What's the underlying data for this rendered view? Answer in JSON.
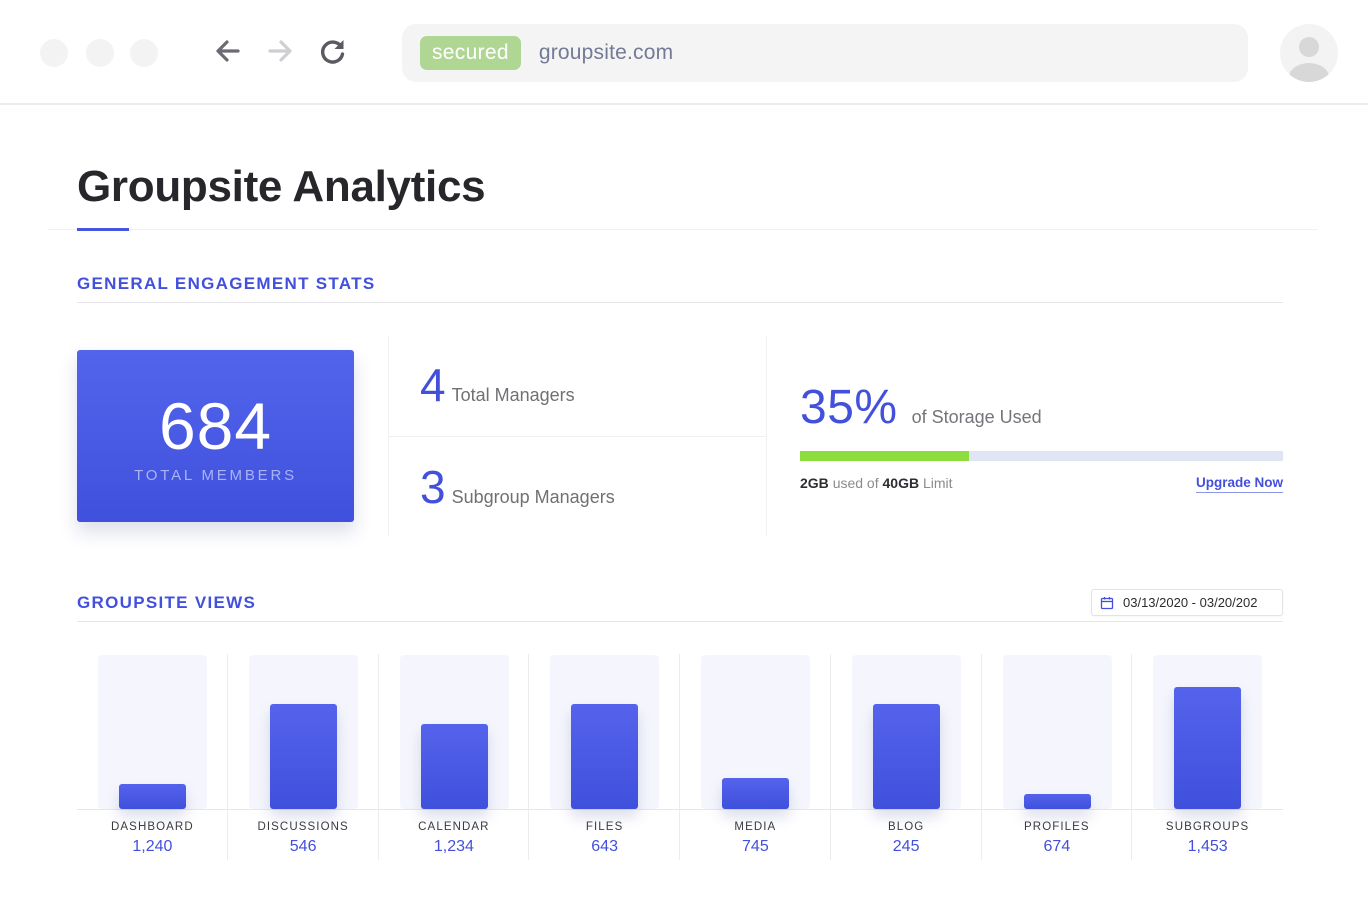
{
  "browser": {
    "window_controls": [
      "close",
      "minimize",
      "maximize"
    ],
    "nav": {
      "back_icon": "arrow-left-icon",
      "forward_icon": "arrow-right-icon",
      "reload_icon": "reload-icon"
    },
    "security_badge": "secured",
    "url": "groupsite.com",
    "avatar_icon": "user-avatar-icon"
  },
  "page": {
    "title": "Groupsite Analytics"
  },
  "engagement": {
    "heading": "GENERAL ENGAGEMENT STATS",
    "total_members": {
      "value": "684",
      "label": "TOTAL MEMBERS"
    },
    "managers": [
      {
        "value": "4",
        "label": "Total Managers"
      },
      {
        "value": "3",
        "label": "Subgroup Managers"
      }
    ],
    "storage": {
      "percent_text": "35%",
      "percent_label": "of Storage Used",
      "fill_fraction": 0.35,
      "used": "2GB",
      "used_of_text": "used of",
      "limit": "40GB",
      "limit_text": "Limit",
      "upgrade_label": "Upgrade Now",
      "colors": {
        "fill": "#8edd3e",
        "track": "#dfe5f2"
      }
    }
  },
  "views": {
    "heading": "GROUPSITE VIEWS",
    "date_range": "03/13/2020 - 03/20/202",
    "calendar_icon": "calendar-icon"
  },
  "chart_data": {
    "type": "bar",
    "title": "GROUPSITE VIEWS",
    "categories": [
      "DASHBOARD",
      "DISCUSSIONS",
      "CALENDAR",
      "FILES",
      "MEDIA",
      "BLOG",
      "PROFILES",
      "SUBGROUPS"
    ],
    "values_printed": [
      "1,240",
      "546",
      "1,234",
      "643",
      "745",
      "245",
      "674",
      "1,453"
    ],
    "values": [
      1240,
      546,
      1234,
      643,
      745,
      245,
      674,
      1453
    ],
    "bar_fill_fraction": [
      0.16,
      0.68,
      0.55,
      0.68,
      0.2,
      0.68,
      0.1,
      0.79
    ],
    "xlabel": "",
    "ylabel": "",
    "grid": false,
    "colors": {
      "bar": "#4757e4",
      "track": "#f5f6fd",
      "value_text": "#4250dc"
    }
  },
  "theme": {
    "accent": "#4250dc",
    "card_gradient": [
      "#5364ec",
      "#3f51dc"
    ],
    "secured_badge": "#afd793"
  }
}
